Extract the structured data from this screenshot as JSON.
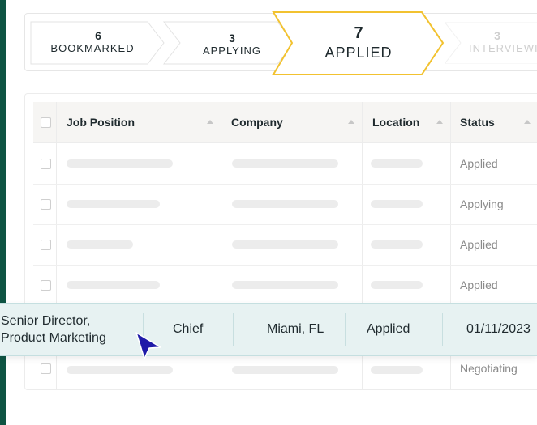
{
  "pipeline": {
    "stages": [
      {
        "count": "6",
        "label": "BOOKMARKED"
      },
      {
        "count": "3",
        "label": "APPLYING"
      },
      {
        "count": "7",
        "label": "APPLIED"
      },
      {
        "count": "3",
        "label": "INTERVIEWING"
      }
    ],
    "active_color": "#f2c230"
  },
  "table": {
    "columns": [
      "Job Position",
      "Company",
      "Location",
      "Status"
    ],
    "rows": [
      {
        "status": "Applied"
      },
      {
        "status": "Applying"
      },
      {
        "status": "Applied"
      },
      {
        "status": "Applied"
      },
      {
        "status": "Negotiating"
      }
    ]
  },
  "highlighted_row": {
    "position": "Senior Director,\nProduct Marketing",
    "company": "Chief",
    "location": "Miami, FL",
    "status": "Applied",
    "date": "01/11/2023"
  },
  "colors": {
    "brand": "#0e5443",
    "highlight_bg": "#e7f2f2"
  },
  "icons": [
    "cursor-arrow-icon",
    "sort-arrow-icon"
  ]
}
